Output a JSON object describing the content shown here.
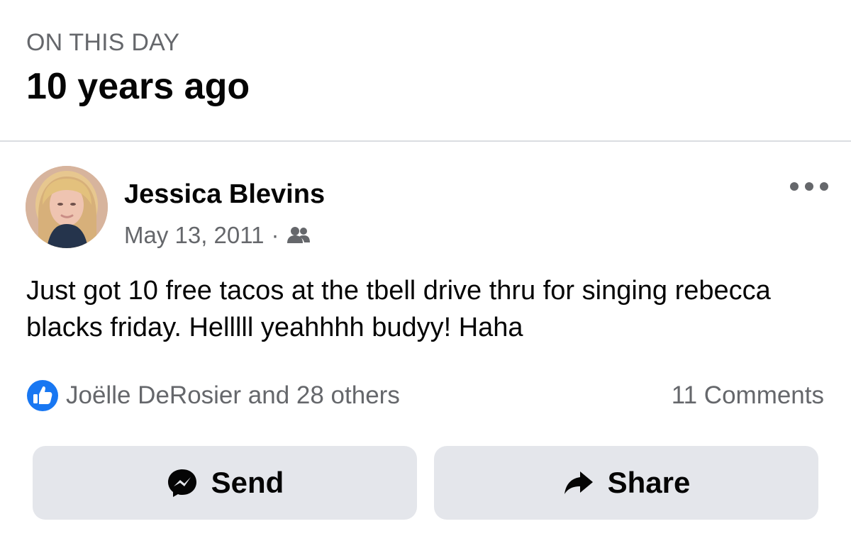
{
  "memory_header": {
    "eyebrow": "ON THIS DAY",
    "headline": "10 years ago"
  },
  "post": {
    "author": "Jessica Blevins",
    "date": "May 13, 2011",
    "separator": "·",
    "audience_icon": "friends-icon",
    "more_icon": "more-options-icon",
    "text": "Just got 10 free tacos at the tbell drive thru for singing rebecca blacks friday. Helllll yeahhhh budyy! Haha",
    "reactions_summary": "Joëlle DeRosier and 28 others",
    "reaction_icon": "like-reaction-icon",
    "comments_count": "11 Comments"
  },
  "actions": {
    "send_label": "Send",
    "send_icon": "messenger-icon",
    "share_label": "Share",
    "share_icon": "share-arrow-icon"
  },
  "colors": {
    "primary_text": "#050505",
    "secondary_text": "#65676b",
    "button_background": "#e4e6eb",
    "divider": "#dadde1",
    "like_blue": "#1877f2"
  }
}
